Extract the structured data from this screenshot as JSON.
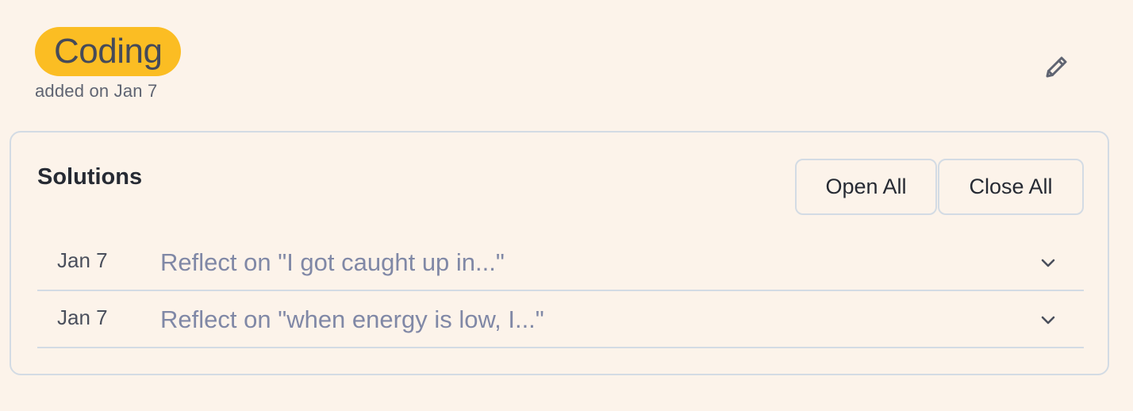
{
  "tag": {
    "label": "Coding",
    "added_on": "added on Jan 7",
    "color": "#fbbd23"
  },
  "header": {
    "edit_icon": "pencil-icon"
  },
  "solutions": {
    "title": "Solutions",
    "open_all_label": "Open All",
    "close_all_label": "Close All",
    "items": [
      {
        "date": "Jan 7",
        "title": "Reflect on \"I got caught up in...\"",
        "icon": "chevron-down-icon"
      },
      {
        "date": "Jan 7",
        "title": "Reflect on \"when energy is low, I...\"",
        "icon": "chevron-down-icon"
      }
    ]
  },
  "colors": {
    "background": "#fcf3ea",
    "border": "#d3dbe4",
    "muted_title": "#8088a6",
    "accent": "#fbbd23"
  }
}
